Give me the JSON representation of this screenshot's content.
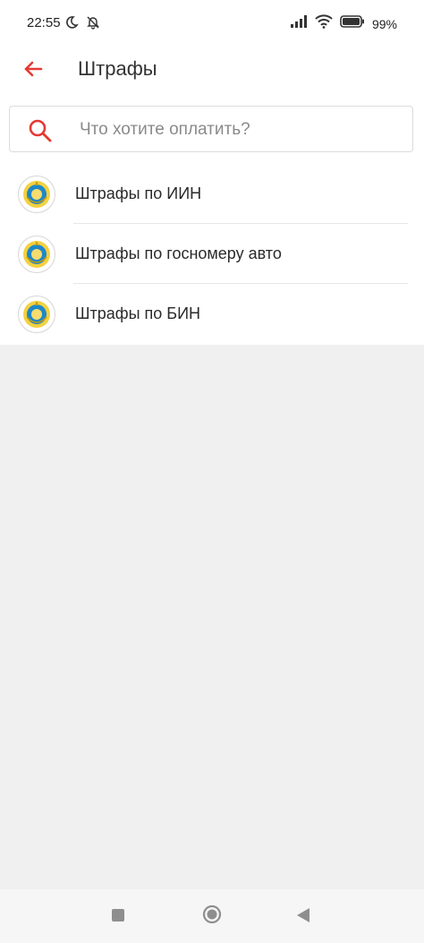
{
  "status_bar": {
    "time": "22:55",
    "battery": "99%",
    "icons": [
      "moon-icon",
      "bell-off-icon",
      "signal-icon",
      "wifi-icon",
      "battery-icon"
    ]
  },
  "app_bar": {
    "title": "Штрафы",
    "back_icon": "arrow-left-icon",
    "accent_color": "#e53935"
  },
  "search": {
    "placeholder": "Что хотите оплатить?",
    "value": ""
  },
  "list": {
    "items": [
      {
        "label": "Штрафы по ИИН",
        "icon": "kazakhstan-emblem-icon"
      },
      {
        "label": "Штрафы по госномеру авто",
        "icon": "kazakhstan-emblem-icon"
      },
      {
        "label": "Штрафы по БИН",
        "icon": "kazakhstan-emblem-icon"
      }
    ]
  },
  "nav_bar": {
    "icons": [
      "recent-apps-icon",
      "home-icon",
      "back-triangle-icon"
    ]
  }
}
